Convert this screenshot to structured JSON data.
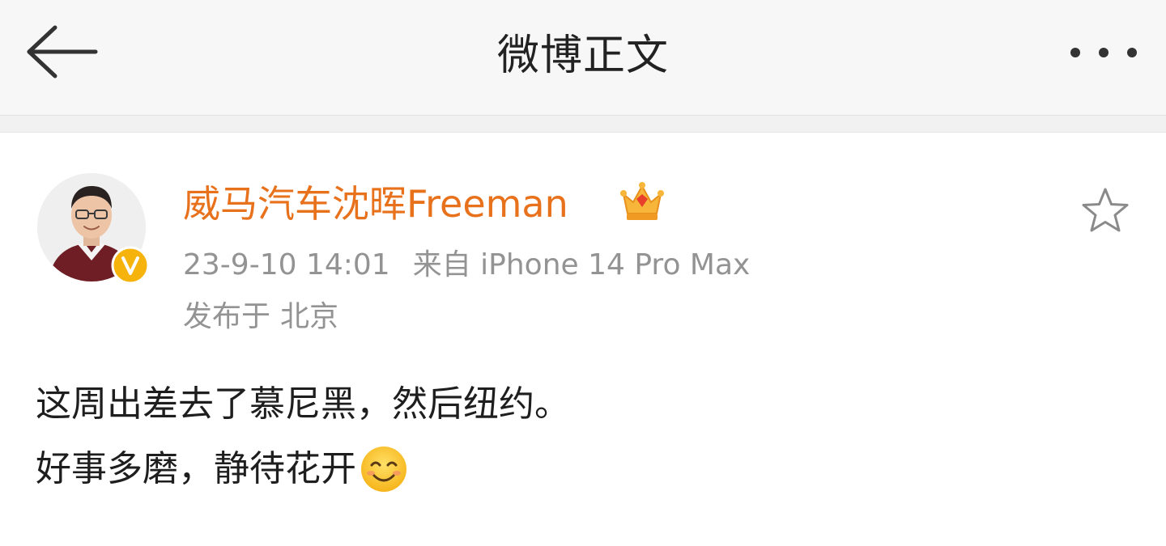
{
  "header": {
    "title": "微博正文",
    "back_icon": "arrow-left-icon",
    "more_icon": "more-dots-icon"
  },
  "post": {
    "author": {
      "name": "威马汽车沈晖Freeman",
      "verified_icon": "verified-v-icon",
      "vip_icon": "vip-crown-icon",
      "name_color": "#e8711c"
    },
    "timestamp": "23-9-10 14:01",
    "source": "来自 iPhone 14 Pro Max",
    "location_prefix": "发布于",
    "location": "北京",
    "favorite_icon": "star-outline-icon",
    "text_lines": [
      "这周出差去了慕尼黑，然后纽约。",
      "好事多磨，静待花开"
    ],
    "emoji_icon": "smiling-face-emoji"
  },
  "colors": {
    "accent": "#e8711c",
    "meta_text": "#939393",
    "body_text": "#1e1e1e",
    "header_bg": "#f7f7f7",
    "badge": "#f5b30c"
  }
}
